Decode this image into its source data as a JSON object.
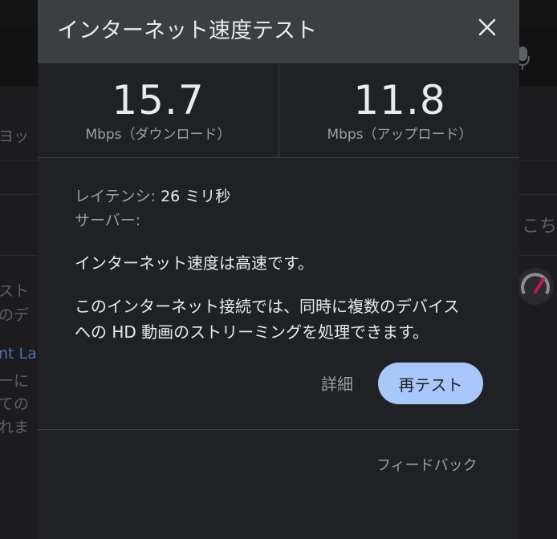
{
  "background": {
    "fragments": [
      "ヨッ",
      "こち",
      "スト",
      "のデ",
      "nt La",
      "ーに",
      "ての",
      "れま"
    ]
  },
  "dialog": {
    "title": "インターネット速度テスト",
    "close_icon": "close-icon",
    "download": {
      "value": "15.7",
      "unit": "Mbps（ダウンロード）"
    },
    "upload": {
      "value": "11.8",
      "unit": "Mbps（アップロード）"
    },
    "latency": {
      "label": "レイテンシ: ",
      "value": "26 ミリ秒"
    },
    "server": {
      "label": "サーバー:",
      "value": ""
    },
    "verdict": "インターネット速度は高速です。",
    "description": {
      "line1": "このインターネット接続では、同時に複数のデバイス",
      "line2": "への HD 動画のストリーミングを処理できます。"
    },
    "details_label": "詳細",
    "retest_label": "再テスト",
    "feedback_label": "フィードバック"
  },
  "colors": {
    "header_bg": "#3c3f42",
    "dialog_bg": "#202124",
    "accent_button": "#a8c7fa",
    "text_primary": "#e8eaed",
    "text_secondary": "#9aa0a6"
  }
}
